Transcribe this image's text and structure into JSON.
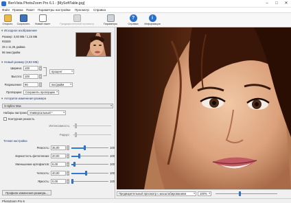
{
  "window": {
    "title": "BenVista PhotoZoom Pro 6.1 - [MySoftTable.jpg]",
    "controls": [
      "–",
      "□",
      "✕"
    ]
  },
  "menu": [
    "Файл",
    "Правка",
    "Пакет",
    "Параметры настройки",
    "Просмотр",
    "Справка"
  ],
  "toolbar": {
    "open": "Открыть",
    "save": "Сохранить",
    "batch": "Новый пакет",
    "preview": "Предварительный просмотр",
    "settings": "Параметры",
    "help": "Справка",
    "info": "Информация"
  },
  "source": {
    "header": "Исходное изображение",
    "size": "Размер: 3,93 МБ / 1,15 МБ",
    "color": "RGB/8",
    "dims": "25 x 11,25 дюйма",
    "dpi": "96 пикс/дюйм"
  },
  "new_size": {
    "header": "Новый размер (3,93 МБ)",
    "width_label": "Ширина:",
    "width_value": "100",
    "height_label": "Высота:",
    "height_value": "100",
    "unit": "процент",
    "resolution_label": "Разрешение:",
    "resolution_value": "96",
    "resolution_unit": "пкс/дюйм",
    "proportions_label": "Пропорции:",
    "proportions_value": "Сохранять пропорции"
  },
  "algorithm": {
    "header": "Алгоритм изменения размера",
    "method": "S-Spline Max",
    "preset_label": "Наборы настроек:",
    "preset_value": "Универсальный *",
    "sharpness_checkbox": "Контурная резкость",
    "intensity_label": "Интенсивность:",
    "radius_label": "Радиус:",
    "intensity_value": 0.05,
    "radius_value": 0.05
  },
  "fine_tune": {
    "header": "Точная настройка",
    "rows": [
      {
        "label": "Резкость:",
        "value": "35,00",
        "max": "100",
        "level": 0.35
      },
      {
        "label": "Зернистость фотопленки:",
        "value": "20,00",
        "max": "100",
        "level": 0.2
      },
      {
        "label": "Уменьшение артефактов:",
        "value": "6,00",
        "max": "100",
        "level": 0.06
      },
      {
        "label": "Четкость:",
        "value": "40,00",
        "max": "100",
        "level": 0.4
      },
      {
        "label": "Яркость:",
        "value": "0,00",
        "max": "100",
        "level": 0.0
      }
    ]
  },
  "profiles_button": "Профили изменения размера...",
  "preview": {
    "mode": "Предварительный просмотр с масштабированием",
    "zoom": "100%"
  },
  "status": "PhotoZoom Pro 6"
}
